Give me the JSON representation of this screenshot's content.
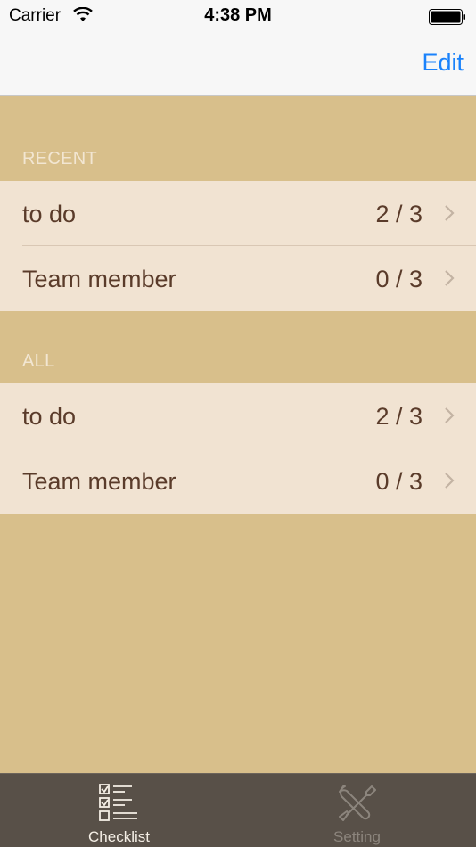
{
  "status_bar": {
    "carrier": "Carrier",
    "time": "4:38 PM"
  },
  "nav": {
    "edit_label": "Edit"
  },
  "sections": [
    {
      "title": "RECENT",
      "rows": [
        {
          "title": "to do",
          "count": "2 / 3"
        },
        {
          "title": "Team member",
          "count": "0 / 3"
        }
      ]
    },
    {
      "title": "ALL",
      "rows": [
        {
          "title": "to do",
          "count": "2 / 3"
        },
        {
          "title": "Team member",
          "count": "0 / 3"
        }
      ]
    }
  ],
  "tab_bar": {
    "tabs": [
      {
        "label": "Checklist",
        "icon": "checklist-icon",
        "active": true
      },
      {
        "label": "Setting",
        "icon": "wrench-screwdriver-icon",
        "active": false
      }
    ]
  },
  "colors": {
    "background": "#d8bf8b",
    "cell": "#f1e3d2",
    "text": "#5a3b2a",
    "accent": "#1a82fb",
    "tab_bar": "#585048"
  }
}
